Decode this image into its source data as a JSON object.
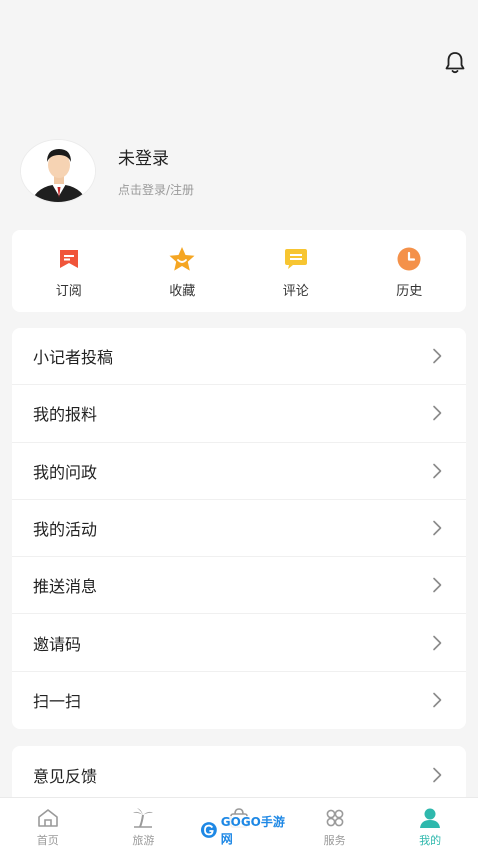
{
  "profile": {
    "name": "未登录",
    "subtitle": "点击登录/注册"
  },
  "quick_actions": [
    {
      "label": "订阅",
      "icon": "subscribe-icon",
      "color": "#f0553a"
    },
    {
      "label": "收藏",
      "icon": "favorite-star-icon",
      "color": "#f5a623"
    },
    {
      "label": "评论",
      "icon": "comment-icon",
      "color": "#f7c531"
    },
    {
      "label": "历史",
      "icon": "history-clock-icon",
      "color": "#f4914a"
    }
  ],
  "menu": {
    "items": [
      {
        "label": "小记者投稿"
      },
      {
        "label": "我的报料"
      },
      {
        "label": "我的问政"
      },
      {
        "label": "我的活动"
      },
      {
        "label": "推送消息"
      },
      {
        "label": "邀请码"
      },
      {
        "label": "扫一扫"
      }
    ],
    "feedback": {
      "label": "意见反馈"
    }
  },
  "tabbar": {
    "tabs": [
      {
        "label": "首页",
        "icon": "home-icon"
      },
      {
        "label": "旅游",
        "icon": "travel-palm-icon"
      },
      {
        "label": "",
        "icon": "shopping-bag-icon"
      },
      {
        "label": "服务",
        "icon": "service-grid-icon"
      },
      {
        "label": "我的",
        "icon": "user-icon"
      }
    ],
    "active_color": "#2fb8ad"
  },
  "watermark": "GOGO手游网"
}
